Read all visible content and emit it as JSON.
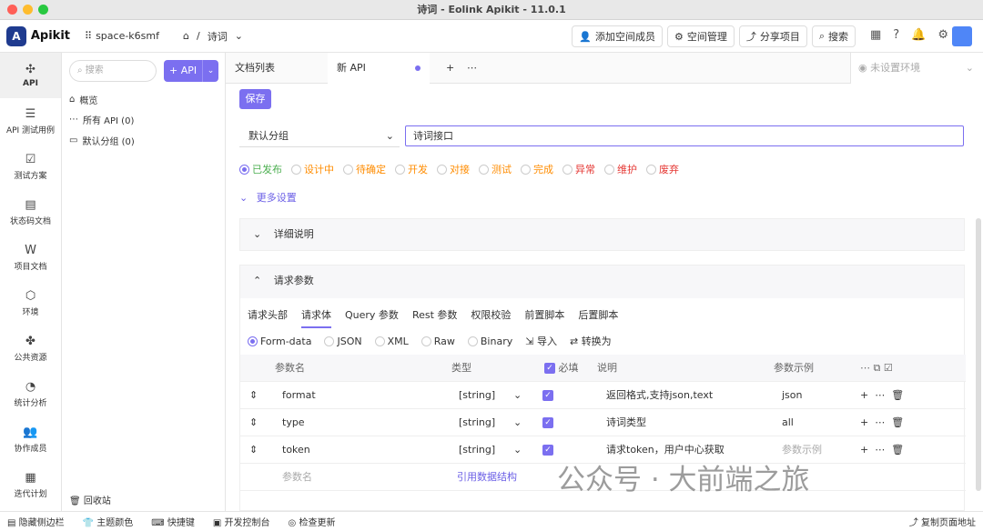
{
  "window": {
    "title": "诗词 - Eolink Apikit - 11.0.1"
  },
  "topbar": {
    "logo": "Apikit",
    "space": "space-k6smf",
    "breadcrumb": "诗词",
    "buttons": [
      "添加空间成员",
      "空间管理",
      "分享项目",
      "搜索"
    ]
  },
  "leftnav": [
    {
      "label": "API",
      "active": true
    },
    {
      "label": "API 测试用例"
    },
    {
      "label": "测试方案"
    },
    {
      "label": "状态码文档"
    },
    {
      "label": "项目文档"
    },
    {
      "label": "环境"
    },
    {
      "label": "公共资源"
    },
    {
      "label": "统计分析"
    },
    {
      "label": "协作成员"
    },
    {
      "label": "迭代计划"
    }
  ],
  "tree": {
    "search_placeholder": "搜索",
    "add_label": "+ API",
    "items": [
      "概览",
      "所有 API (0)",
      "默认分组 (0)"
    ],
    "recycle": "回收站"
  },
  "tabs": {
    "list": "文档列表",
    "new": "新 API",
    "env": "未设置环境"
  },
  "editor": {
    "save": "保存",
    "group": "默认分组",
    "name": "诗词接口",
    "statuses": [
      {
        "label": "已发布",
        "color": "#4caf50",
        "on": true
      },
      {
        "label": "设计中",
        "color": "#ff8c00"
      },
      {
        "label": "待确定",
        "color": "#ff8c00"
      },
      {
        "label": "开发",
        "color": "#ff8c00"
      },
      {
        "label": "对接",
        "color": "#ff8c00"
      },
      {
        "label": "测试",
        "color": "#ff8c00"
      },
      {
        "label": "完成",
        "color": "#ff8c00"
      },
      {
        "label": "异常",
        "color": "#e53935"
      },
      {
        "label": "维护",
        "color": "#e53935"
      },
      {
        "label": "废弃",
        "color": "#e53935"
      }
    ],
    "more": "更多设置",
    "detail": "详细说明",
    "params": "请求参数"
  },
  "subtabs": [
    "请求头部",
    "请求体",
    "Query 参数",
    "Rest 参数",
    "权限校验",
    "前置脚本",
    "后置脚本"
  ],
  "formats": [
    "Form-data",
    "JSON",
    "XML",
    "Raw",
    "Binary",
    "导入",
    "转换为"
  ],
  "grid": {
    "headers": [
      "参数名",
      "类型",
      "必填",
      "说明",
      "参数示例"
    ],
    "rows": [
      [
        "format",
        "[string]",
        "返回格式,支持json,text",
        "json"
      ],
      [
        "type",
        "[string]",
        "诗词类型",
        "all"
      ],
      [
        "token",
        "[string]",
        "请求token，用户中心获取",
        "参数示例"
      ]
    ],
    "new_param": "参数名",
    "ref": "引用数据结构"
  },
  "status": [
    "隐藏侧边栏",
    "主题颜色",
    "快捷键",
    "开发控制台",
    "检查更新",
    "复制页面地址"
  ],
  "watermark": "公众号 · 大前端之旅"
}
